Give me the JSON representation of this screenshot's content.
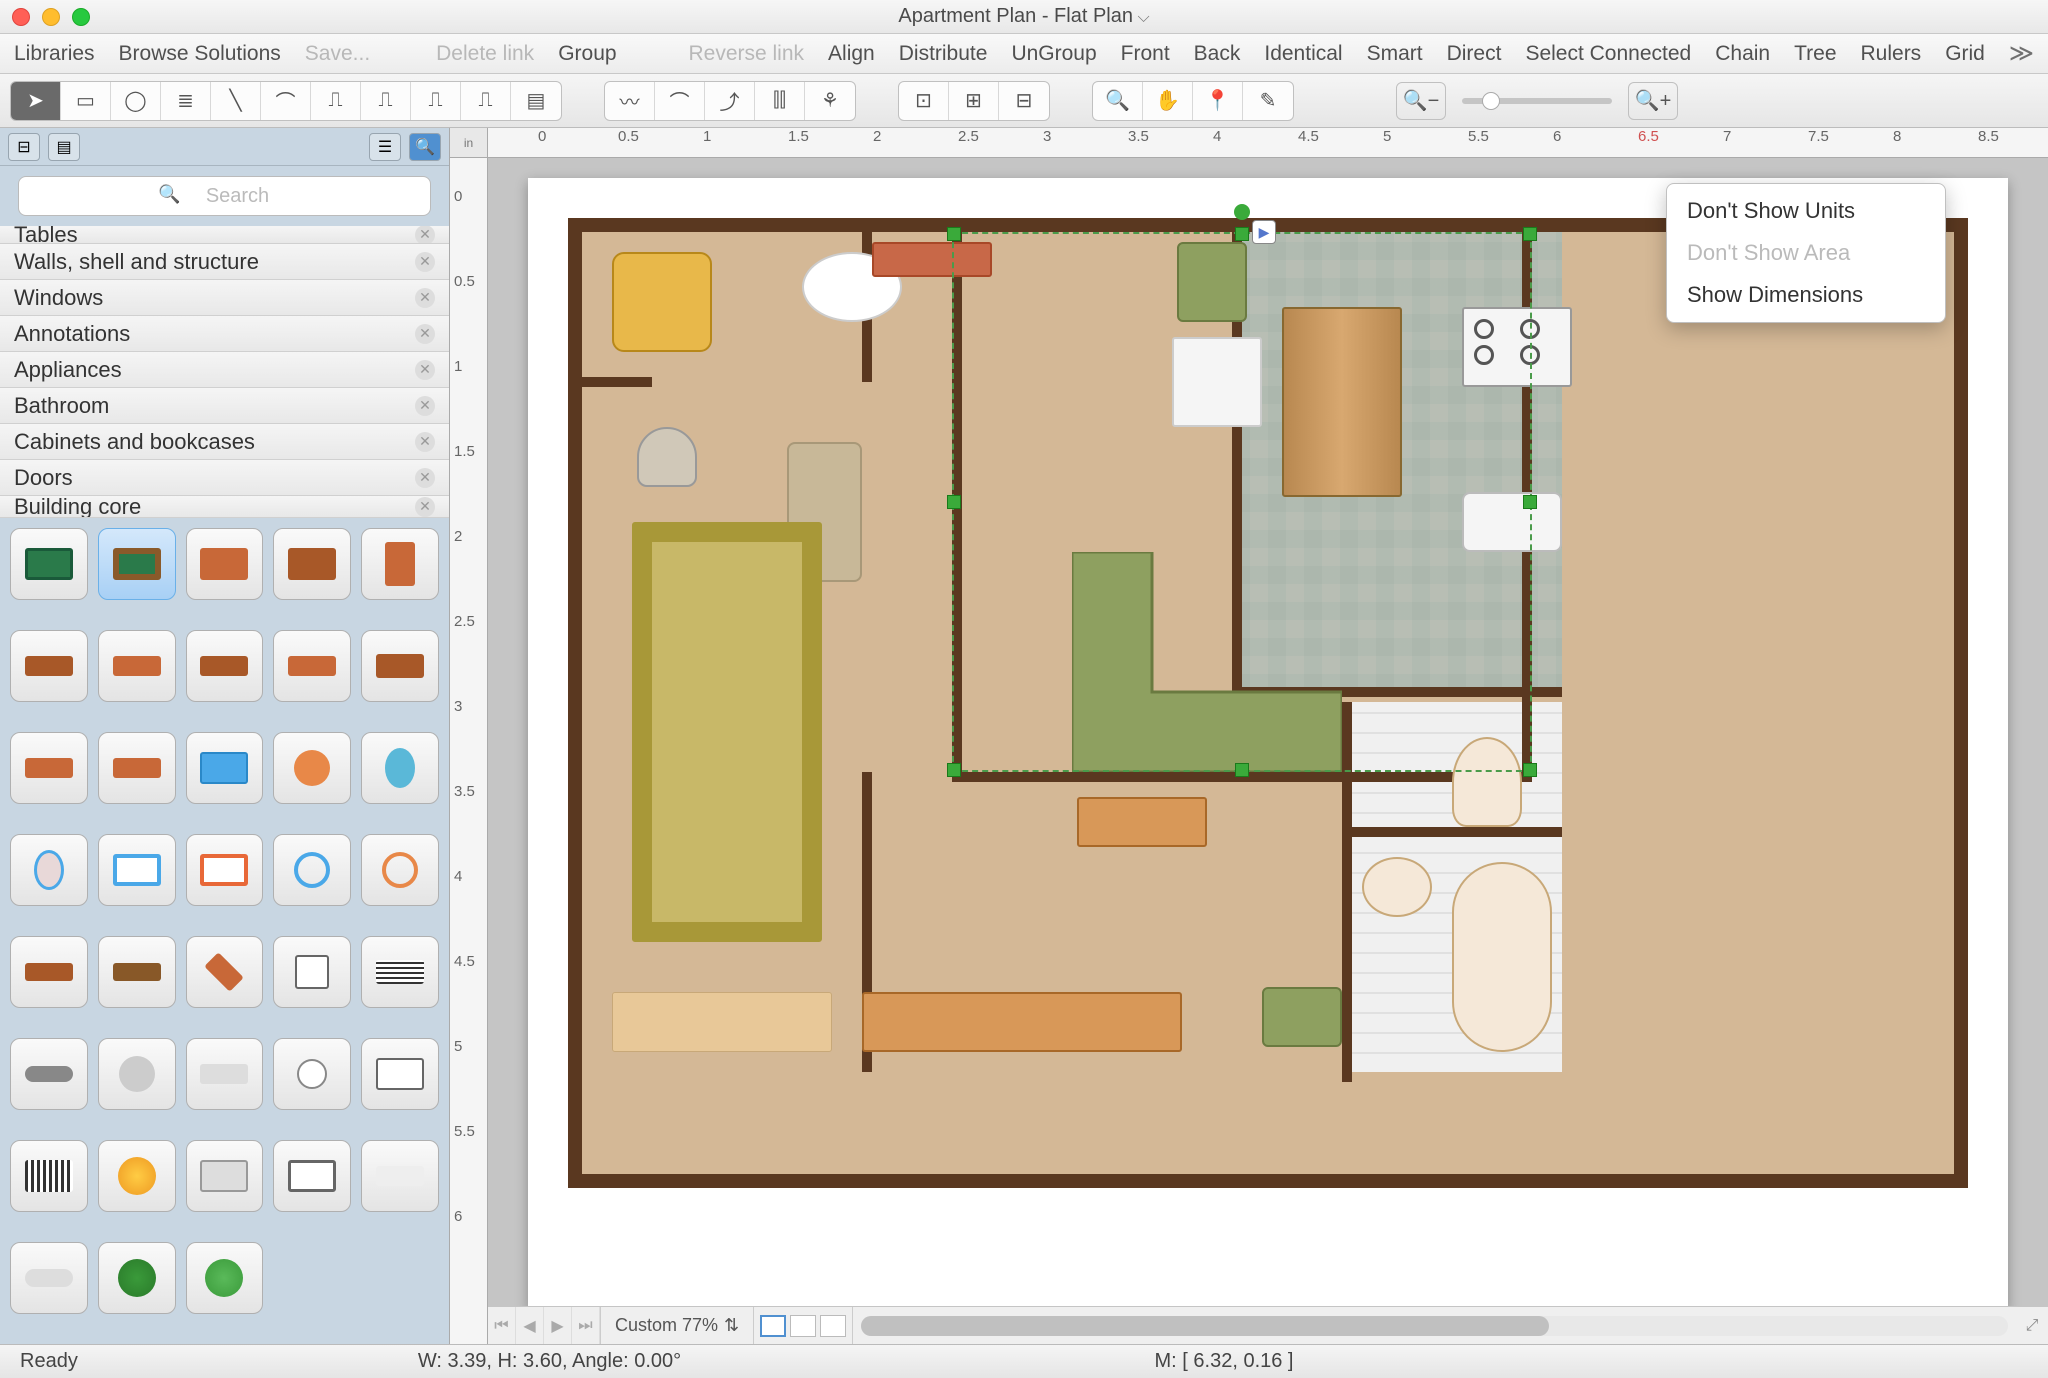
{
  "window": {
    "title": "Apartment Plan - Flat Plan"
  },
  "menubar": {
    "items": [
      {
        "label": "Libraries",
        "disabled": false
      },
      {
        "label": "Browse Solutions",
        "disabled": false
      },
      {
        "label": "Save...",
        "disabled": true
      },
      {
        "label": "Delete link",
        "disabled": true
      },
      {
        "label": "Group",
        "disabled": false
      },
      {
        "label": "Reverse link",
        "disabled": true
      },
      {
        "label": "Align",
        "disabled": false
      },
      {
        "label": "Distribute",
        "disabled": false
      },
      {
        "label": "UnGroup",
        "disabled": false
      },
      {
        "label": "Front",
        "disabled": false
      },
      {
        "label": "Back",
        "disabled": false
      },
      {
        "label": "Identical",
        "disabled": false
      },
      {
        "label": "Smart",
        "disabled": false
      },
      {
        "label": "Direct",
        "disabled": false
      },
      {
        "label": "Select Connected",
        "disabled": false
      },
      {
        "label": "Chain",
        "disabled": false
      },
      {
        "label": "Tree",
        "disabled": false
      },
      {
        "label": "Rulers",
        "disabled": false
      },
      {
        "label": "Grid",
        "disabled": false
      }
    ]
  },
  "sidebar": {
    "search_placeholder": "Search",
    "categories": [
      "Tables",
      "Walls, shell and structure",
      "Windows",
      "Annotations",
      "Appliances",
      "Bathroom",
      "Cabinets and bookcases",
      "Doors",
      "Building core"
    ]
  },
  "ruler": {
    "unit": "in",
    "h_labels": [
      "0",
      "0.5",
      "1",
      "1.5",
      "2",
      "2.5",
      "3",
      "3.5",
      "4",
      "4.5",
      "5",
      "5.5",
      "6",
      "6.5",
      "7",
      "7.5",
      "8",
      "8.5"
    ],
    "v_labels": [
      "0",
      "0.5",
      "1",
      "1.5",
      "2",
      "2.5",
      "3",
      "3.5",
      "4",
      "4.5",
      "5",
      "5.5",
      "6"
    ]
  },
  "context_menu": {
    "items": [
      {
        "label": "Don't Show Units",
        "disabled": false
      },
      {
        "label": "Don't Show Area",
        "disabled": true
      },
      {
        "label": "Show Dimensions",
        "disabled": false
      }
    ]
  },
  "zoom": {
    "label": "Custom 77%"
  },
  "status": {
    "ready": "Ready",
    "dims": "W: 3.39,  H: 3.60,  Angle: 0.00°",
    "mouse": "M: [ 6.32, 0.16 ]"
  }
}
